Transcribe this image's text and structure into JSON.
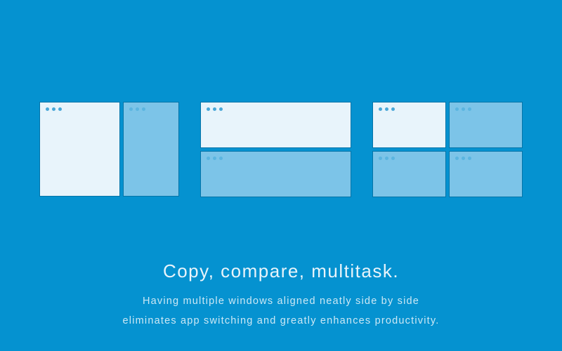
{
  "headline": "Copy, compare, multitask.",
  "subtext_line1": "Having multiple windows aligned neatly side by side",
  "subtext_line2": "eliminates app switching and greatly enhances productivity."
}
